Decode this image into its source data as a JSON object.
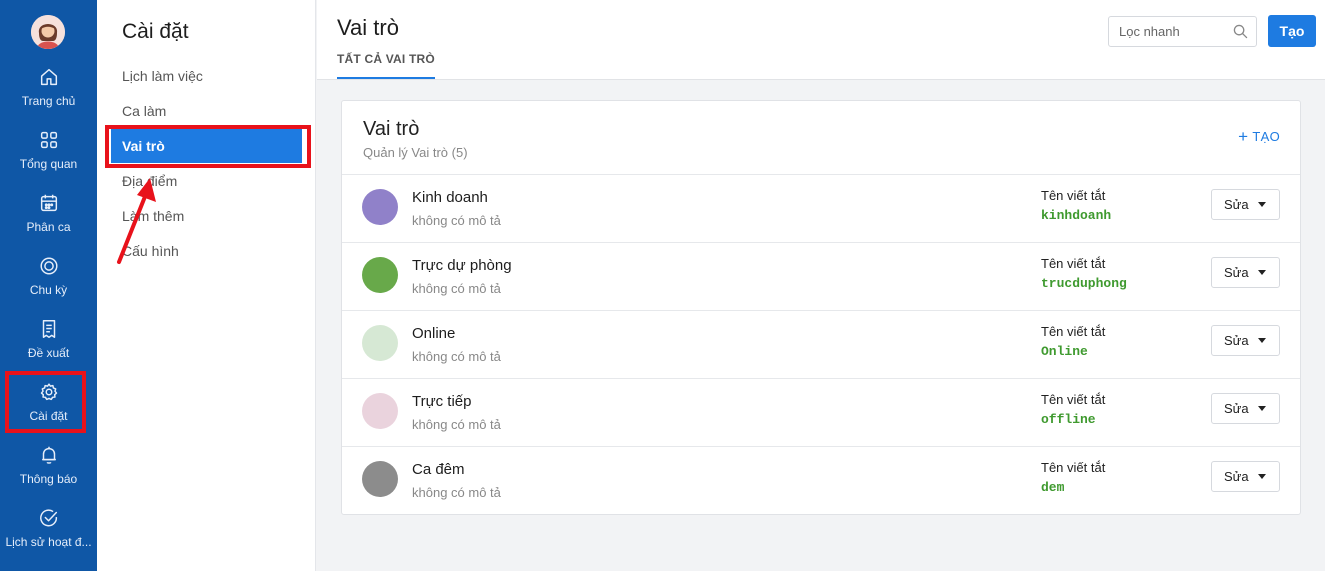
{
  "nav": {
    "items": [
      {
        "label": "Trang chủ",
        "icon": "home-icon"
      },
      {
        "label": "Tổng quan",
        "icon": "grid-icon"
      },
      {
        "label": "Phân ca",
        "icon": "calendar-icon"
      },
      {
        "label": "Chu kỳ",
        "icon": "cycle-icon"
      },
      {
        "label": "Đề xuất",
        "icon": "document-icon"
      },
      {
        "label": "Cài đặt",
        "icon": "gear-icon"
      },
      {
        "label": "Thông báo",
        "icon": "bell-icon"
      },
      {
        "label": "Lịch sử hoạt đ...",
        "icon": "check-circle-icon"
      }
    ]
  },
  "settings_menu": {
    "title": "Cài đặt",
    "items": [
      {
        "label": "Lịch làm việc"
      },
      {
        "label": "Ca làm"
      },
      {
        "label": "Vai trò"
      },
      {
        "label": "Địa điểm"
      },
      {
        "label": "Làm thêm"
      },
      {
        "label": "Cấu hình"
      }
    ]
  },
  "header": {
    "title": "Vai trò",
    "tab": "TẤT CẢ VAI TRÒ",
    "search_placeholder": "Lọc nhanh",
    "create_label": "Tạo"
  },
  "card": {
    "title": "Vai trò",
    "subtitle": "Quản lý Vai trò (5)",
    "add_label": "TẠO",
    "abbr_label": "Tên viết tắt",
    "edit_label": "Sửa",
    "roles": [
      {
        "name": "Kinh doanh",
        "desc": "không có mô tả",
        "abbr": "kinhdoanh",
        "color": "#9081c9"
      },
      {
        "name": "Trực dự phòng",
        "desc": "không có mô tả",
        "abbr": "trucduphong",
        "color": "#68a94a"
      },
      {
        "name": "Online",
        "desc": "không có mô tả",
        "abbr": "Online",
        "color": "#d6e8d4"
      },
      {
        "name": "Trực tiếp",
        "desc": "không có mô tả",
        "abbr": "offline",
        "color": "#ead3dd"
      },
      {
        "name": "Ca đêm",
        "desc": "không có mô tả",
        "abbr": "dem",
        "color": "#8c8c8c"
      }
    ]
  },
  "colors": {
    "rail": "#0f57a6",
    "accent": "#1e7be1",
    "abbr_green": "#3f9a2f",
    "highlight": "#e8121b"
  }
}
